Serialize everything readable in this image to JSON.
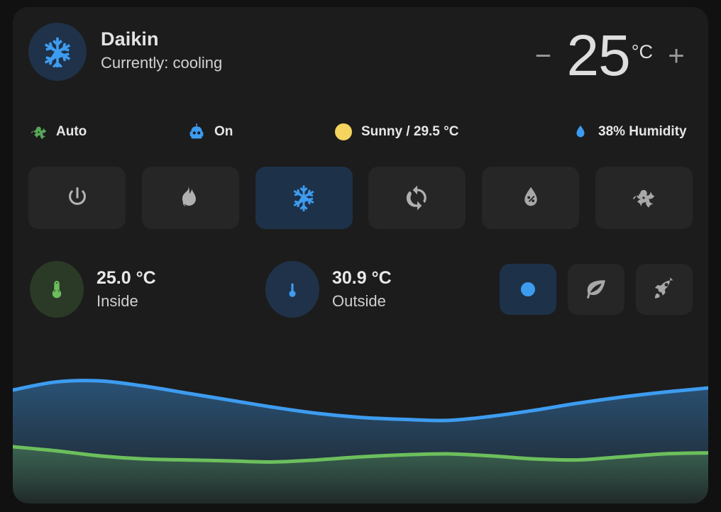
{
  "card": {
    "device_icon": "snowflake-icon",
    "title": "Daikin",
    "state_text": "Currently: cooling",
    "accent_color": "#3d9cf0",
    "card_background": "#1c1c1c",
    "page_background": "#111111"
  },
  "temperature_control": {
    "decrease_label": "−",
    "increase_label": "+",
    "target_value": "25",
    "unit": "°C"
  },
  "status_chips": [
    {
      "icon": "fan-icon",
      "label": "Auto",
      "color": "#57a85a"
    },
    {
      "icon": "robot-icon",
      "label": "On",
      "color": "#3d9cf0"
    },
    {
      "icon": "sun-icon",
      "label": "Sunny / 29.5 °C",
      "color": "#f4d35e"
    },
    {
      "icon": "water-percent-icon",
      "label": "38% Humidity",
      "color": "#3d9cf0"
    }
  ],
  "hvac_modes": [
    {
      "icon": "power-icon",
      "name": "off",
      "active": false
    },
    {
      "icon": "fire-icon",
      "name": "heat",
      "active": false
    },
    {
      "icon": "snowflake-icon",
      "name": "cool",
      "active": true
    },
    {
      "icon": "autorenew-icon",
      "name": "auto",
      "active": false
    },
    {
      "icon": "water-percent-icon",
      "name": "dry",
      "active": false
    },
    {
      "icon": "fan-icon",
      "name": "fan_only",
      "active": false
    }
  ],
  "sensors": [
    {
      "icon": "thermometer-icon",
      "value": "25.0 °C",
      "label": "Inside",
      "color": "#6cbf5c"
    },
    {
      "icon": "thermometer-icon",
      "value": "30.9 °C",
      "label": "Outside",
      "color": "#3d9cf0"
    }
  ],
  "presets": [
    {
      "icon": "circle-dot-icon",
      "name": "none",
      "active": true
    },
    {
      "icon": "leaf-icon",
      "name": "eco",
      "active": false
    },
    {
      "icon": "rocket-icon",
      "name": "boost",
      "active": false
    }
  ],
  "chart_data": {
    "type": "area",
    "title": "",
    "xlabel": "",
    "ylabel": "",
    "grid": false,
    "legend": "none",
    "ylim": [
      20,
      34
    ],
    "x": [
      0,
      1,
      2,
      3,
      4,
      5,
      6,
      7,
      8,
      9,
      10,
      11,
      12,
      13,
      14,
      15,
      16
    ],
    "series": [
      {
        "name": "Outside",
        "color": "#3d9cf0",
        "values": [
          31.2,
          32.0,
          32.1,
          31.6,
          30.9,
          30.2,
          29.5,
          28.9,
          28.5,
          28.3,
          28.2,
          28.6,
          29.2,
          29.9,
          30.5,
          31.0,
          31.4
        ]
      },
      {
        "name": "Inside",
        "color": "#6cbf5c",
        "values": [
          25.6,
          25.2,
          24.7,
          24.4,
          24.3,
          24.2,
          24.1,
          24.3,
          24.6,
          24.8,
          24.9,
          24.7,
          24.4,
          24.3,
          24.6,
          24.9,
          25.0
        ]
      }
    ]
  }
}
